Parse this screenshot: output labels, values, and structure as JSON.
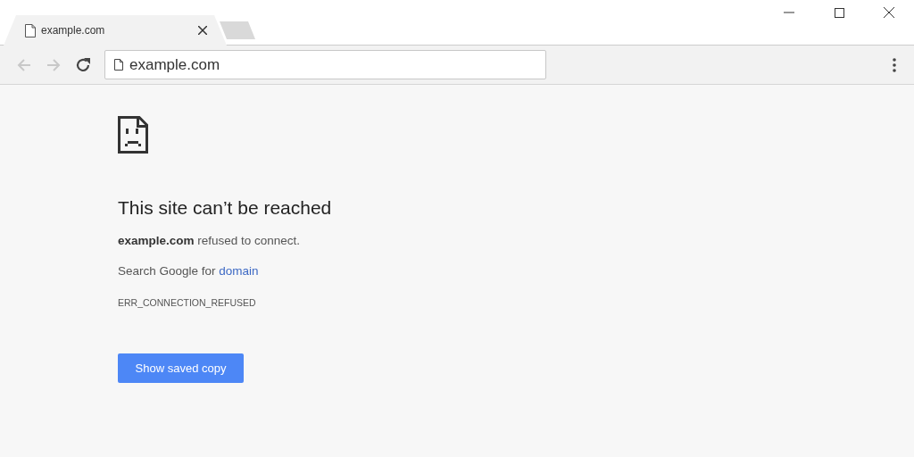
{
  "tabs": [
    {
      "title": "example.com",
      "selected": true
    }
  ],
  "navigation": {
    "back_disabled": true,
    "forward_disabled": true
  },
  "address_bar": {
    "value": "example.com"
  },
  "error": {
    "heading": "This site can’t be reached",
    "message": "**example.com** refused to connect.",
    "search_prefix": "Search Google for",
    "search_link": "domain",
    "code": "ERR_CONNECTION_REFUSED",
    "button": "Show saved copy"
  }
}
